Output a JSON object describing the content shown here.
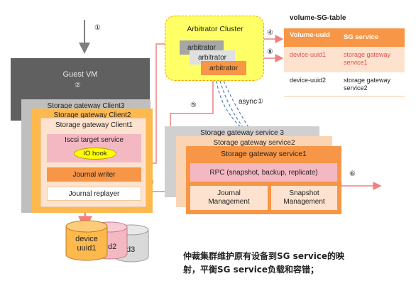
{
  "steps": {
    "s1": "①",
    "s2": "②",
    "s4": "④",
    "s5": "⑤",
    "s6": "⑥",
    "s7": "⑦",
    "s8": "⑧",
    "async": "async①"
  },
  "guest_vm": {
    "title": "Guest VM",
    "client3": "Storage gateway Client3",
    "client2": "Storage gateway Client2",
    "client1": "Storage gateway Client1",
    "iscsi": "Iscsi target service",
    "io_hook": "IO hook",
    "journal_writer": "Journal writer",
    "journal_replayer": "Journal replayer"
  },
  "arbitrator": {
    "cluster_title": "Arbitrator Cluster",
    "node1": "arbitrator",
    "node2": "arbitrator",
    "node3": "arbitrator"
  },
  "table": {
    "title": "volume-SG-table",
    "headers": [
      "Volume-uuid",
      "SG service"
    ],
    "rows": [
      [
        "device-uuid1",
        "storage gateway service1"
      ],
      [
        "device-uuid2",
        "storage gateway service2"
      ]
    ]
  },
  "services": {
    "svc3": "Storage gateway service 3",
    "svc2": "Storage gateway service2",
    "svc1": "Storage gateway service1",
    "rpc": "RPC (snapshot, backup, replicate)",
    "journal_mgmt": "Journal Management",
    "snapshot_mgmt": "Snapshot Management"
  },
  "devices": {
    "dev1": "device uuid1",
    "dev2": "d2",
    "dev3": "d3"
  },
  "note": "仲裁集群维护原有设备到SG service的映射，平衡SG service负载和容错；",
  "colors": {
    "orange": "#f79646",
    "light_orange": "#fde3cf",
    "pale_orange": "#fbd4b4",
    "pink": "#f4b8c3",
    "yellow": "#ffff00",
    "gray": "#7f7f7f",
    "arrow_red": "#f08080"
  }
}
